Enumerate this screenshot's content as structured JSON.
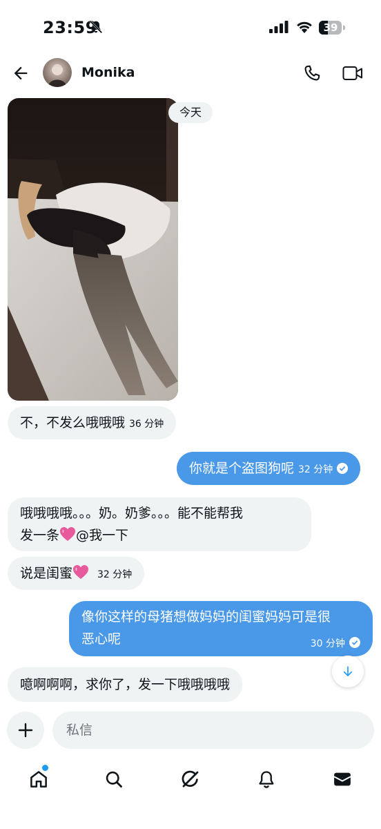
{
  "status_bar": {
    "time": "23:59",
    "battery": "39"
  },
  "header": {
    "contact_name": "Monika"
  },
  "conversation": {
    "day_separator": "今天",
    "messages": [
      {
        "direction": "in",
        "text": "不，不发么哦哦哦",
        "time": "36 分钟"
      },
      {
        "direction": "out",
        "text": "你就是个盗图狗呢",
        "time": "32 分钟",
        "read": true
      },
      {
        "direction": "in",
        "text_line1": "哦哦哦哦。。。奶。奶爹。。。能不能帮我",
        "text_line2_before": "发一条",
        "text_line2_after": "@我一下"
      },
      {
        "direction": "in",
        "text": "说是闺蜜",
        "time": "32 分钟"
      },
      {
        "direction": "out",
        "text_line1": "像你这样的母猪想做妈妈的闺蜜妈妈可是很",
        "text_line2": "恶心呢",
        "time": "30 分钟",
        "read": true
      },
      {
        "direction": "in",
        "text": "噫啊啊啊，求你了，发一下哦哦哦哦"
      }
    ]
  },
  "composer": {
    "placeholder": "私信"
  },
  "colors": {
    "accent": "#1d9bf0",
    "outgoing_bubble": "#4a99e9",
    "incoming_bubble": "#eff3f4",
    "heart": "#e75a9b"
  },
  "bottom_nav": {
    "items": [
      "home-icon",
      "search-icon",
      "grok-icon",
      "notifications-icon",
      "messages-icon"
    ]
  }
}
